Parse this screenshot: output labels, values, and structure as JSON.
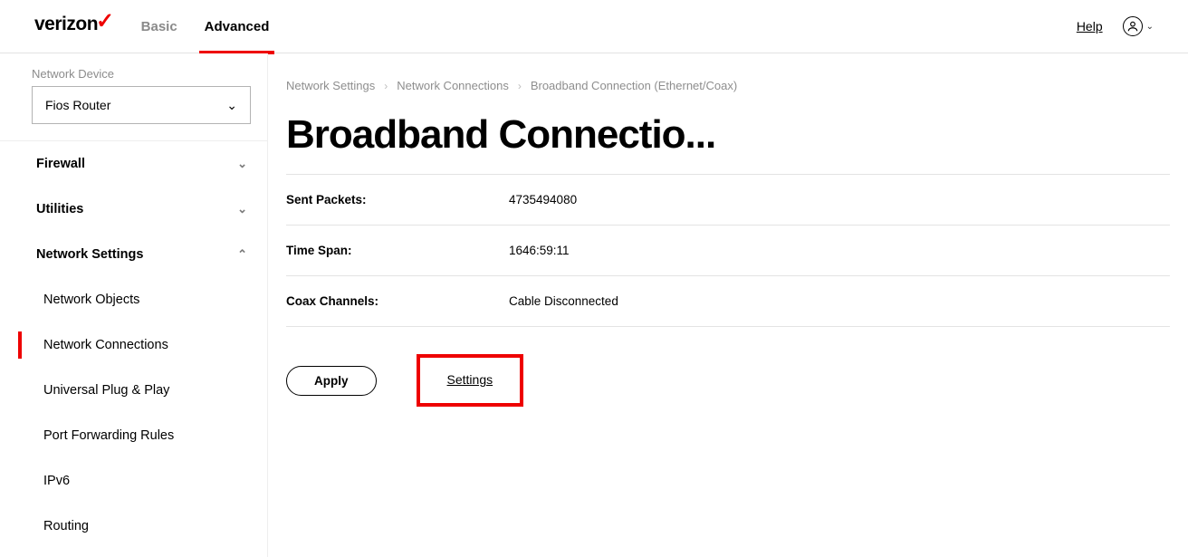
{
  "header": {
    "logo_text": "verizon",
    "tab_basic": "Basic",
    "tab_advanced": "Advanced",
    "help": "Help"
  },
  "sidebar": {
    "device_label": "Network Device",
    "device_value": "Fios Router",
    "groups": {
      "firewall": "Firewall",
      "utilities": "Utilities",
      "network_settings": "Network Settings"
    },
    "subs": {
      "network_objects": "Network Objects",
      "network_connections": "Network Connections",
      "upnp": "Universal Plug & Play",
      "port_forwarding": "Port Forwarding Rules",
      "ipv6": "IPv6",
      "routing": "Routing"
    }
  },
  "breadcrumb": {
    "a": "Network Settings",
    "b": "Network Connections",
    "c": "Broadband Connection (Ethernet/Coax)"
  },
  "page": {
    "title": "Broadband Connectio..."
  },
  "rows": [
    {
      "label": "Sent Packets:",
      "value": "4735494080"
    },
    {
      "label": "Time Span:",
      "value": "1646:59:11"
    },
    {
      "label": "Coax Channels:",
      "value": "Cable Disconnected"
    }
  ],
  "actions": {
    "apply": "Apply",
    "settings": "Settings"
  }
}
